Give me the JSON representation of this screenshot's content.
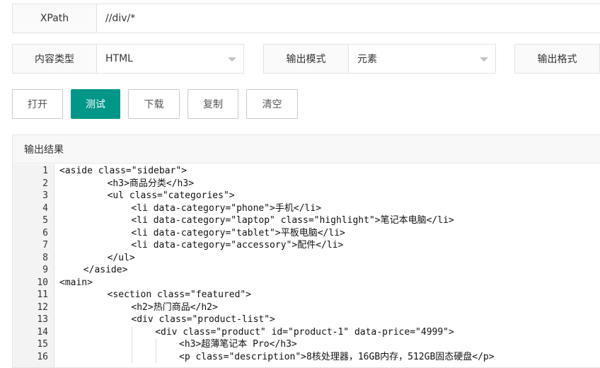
{
  "xpath": {
    "label": "XPath",
    "value": "//div/*"
  },
  "content_type": {
    "label": "内容类型",
    "value": "HTML"
  },
  "output_mode": {
    "label": "输出模式",
    "value": "元素"
  },
  "output_format": {
    "label": "输出格式"
  },
  "buttons": {
    "open": "打开",
    "test": "测试",
    "download": "下载",
    "copy": "复制",
    "clear": "清空"
  },
  "result": {
    "title": "输出结果",
    "lines": [
      {
        "n": "1",
        "indent": 0,
        "text": "<aside class=\"sidebar\">"
      },
      {
        "n": "2",
        "indent": 2,
        "text": "<h3>商品分类</h3>"
      },
      {
        "n": "3",
        "indent": 2,
        "text": "<ul class=\"categories\">"
      },
      {
        "n": "4",
        "indent": 3,
        "text": "<li data-category=\"phone\">手机</li>"
      },
      {
        "n": "5",
        "indent": 3,
        "text": "<li data-category=\"laptop\" class=\"highlight\">笔记本电脑</li>"
      },
      {
        "n": "6",
        "indent": 3,
        "text": "<li data-category=\"tablet\">平板电脑</li>"
      },
      {
        "n": "7",
        "indent": 3,
        "text": "<li data-category=\"accessory\">配件</li>"
      },
      {
        "n": "8",
        "indent": 2,
        "text": "</ul>"
      },
      {
        "n": "9",
        "indent": 1,
        "text": "</aside>"
      },
      {
        "n": "10",
        "indent": 0,
        "text": "<main>"
      },
      {
        "n": "11",
        "indent": 2,
        "text": "<section class=\"featured\">"
      },
      {
        "n": "12",
        "indent": 3,
        "text": "<h2>热门商品</h2>"
      },
      {
        "n": "13",
        "indent": 3,
        "text": "<div class=\"product-list\">"
      },
      {
        "n": "14",
        "indent": 4,
        "text": "<div class=\"product\" id=\"product-1\" data-price=\"4999\">"
      },
      {
        "n": "15",
        "indent": 5,
        "text": "<h3>超薄笔记本 Pro</h3>"
      },
      {
        "n": "16",
        "indent": 5,
        "text": "<p class=\"description\">8核处理器，16GB内存，512GB固态硬盘</p>"
      }
    ]
  }
}
